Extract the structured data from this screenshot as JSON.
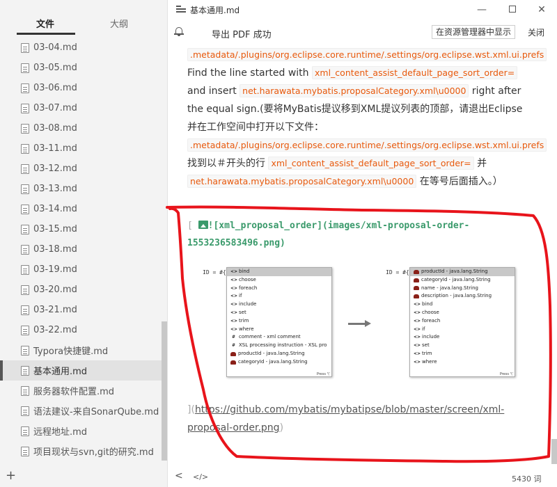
{
  "sidebar": {
    "tabs": [
      {
        "label": "文件"
      },
      {
        "label": "大纲"
      }
    ],
    "files": [
      {
        "name": "03-04.md"
      },
      {
        "name": "03-05.md"
      },
      {
        "name": "03-06.md"
      },
      {
        "name": "03-07.md"
      },
      {
        "name": "03-08.md"
      },
      {
        "name": "03-11.md"
      },
      {
        "name": "03-12.md"
      },
      {
        "name": "03-13.md"
      },
      {
        "name": "03-14.md"
      },
      {
        "name": "03-15.md"
      },
      {
        "name": "03-18.md"
      },
      {
        "name": "03-19.md"
      },
      {
        "name": "03-20.md"
      },
      {
        "name": "03-21.md"
      },
      {
        "name": "03-22.md"
      },
      {
        "name": "Typora快捷键.md"
      },
      {
        "name": "基本通用.md"
      },
      {
        "name": "服务器软件配置.md"
      },
      {
        "name": "语法建议-来自SonarQube.md"
      },
      {
        "name": "远程地址.md"
      },
      {
        "name": "项目现状与svn,git的研究.md"
      }
    ],
    "active_file": "基本通用.md",
    "add_label": "+"
  },
  "window": {
    "title": "基本通用.md",
    "minimize": "—",
    "close": "✕"
  },
  "notice": {
    "message": "导出 PDF 成功",
    "reveal_button": "在资源管理器中显示",
    "close_button": "关闭"
  },
  "editor": {
    "p1": ".metadata/.plugins/org.eclipse.core.runtime/.settings/org.eclipse.wst.xml.ui.prefs",
    "p2": "Find the line started with",
    "p3": "xml_content_assist_default_page_sort_order=",
    "p4": "and insert",
    "p5": "net.harawata.mybatis.proposalCategory.xml\\u0000",
    "p6": "right after the equal sign.(要将MyBatis提议移到XML提议列表的顶部，请退出Eclipse并在工作空间中打开以下文件：",
    "p7": ".metadata/.plugins/org.eclipse.core.runtime/.settings/org.eclipse.wst.xml.ui.prefs",
    "p8": "找到以＃开头的行",
    "p9": "xml_content_assist_default_page_sort_order=",
    "p10": "并",
    "p11": "net.harawata.mybatis.proposalCategory.xml\\u0000",
    "p12": "在等号后面插入。）",
    "image_source": "![xml_proposal_order](images/xml-proposal-order-1553236583496.png)",
    "bracket_open": "[",
    "link_open": "](",
    "link_url": "https://github.com/mybatis/mybatipse/blob/master/screen/xml-proposal-order.png",
    "link_close": ")",
    "figure": {
      "id_line_left": "ID = #{}",
      "id_line_right": "ID = #{}",
      "left_items": [
        {
          "icon": "<>",
          "text": "bind"
        },
        {
          "icon": "<>",
          "text": "choose"
        },
        {
          "icon": "<>",
          "text": "foreach"
        },
        {
          "icon": "<>",
          "text": "if"
        },
        {
          "icon": "<>",
          "text": "include"
        },
        {
          "icon": "<>",
          "text": "set"
        },
        {
          "icon": "<>",
          "text": "trim"
        },
        {
          "icon": "<>",
          "text": "where"
        },
        {
          "icon": "#",
          "text": "comment - xml comment"
        },
        {
          "icon": "#",
          "text": "XSL processing instruction - XSL pro"
        },
        {
          "icon": "obj",
          "text": "productId - java.lang.String"
        },
        {
          "icon": "obj",
          "text": "categoryId - java.lang.String"
        }
      ],
      "right_items": [
        {
          "icon": "obj",
          "text": "productId - java.lang.String"
        },
        {
          "icon": "obj",
          "text": "categoryId - java.lang.String"
        },
        {
          "icon": "obj",
          "text": "name - java.lang.String"
        },
        {
          "icon": "obj",
          "text": "description - java.lang.String"
        },
        {
          "icon": "<>",
          "text": "bind"
        },
        {
          "icon": "<>",
          "text": "choose"
        },
        {
          "icon": "<>",
          "text": "foreach"
        },
        {
          "icon": "<>",
          "text": "if"
        },
        {
          "icon": "<>",
          "text": "include"
        },
        {
          "icon": "<>",
          "text": "set"
        },
        {
          "icon": "<>",
          "text": "trim"
        },
        {
          "icon": "<>",
          "text": "where"
        }
      ],
      "press_hint": "Press '\\'"
    }
  },
  "status": {
    "back": "<",
    "source_toggle": "</>",
    "word_count": "5430 词"
  },
  "annotation": {
    "color": "#e8141b"
  }
}
